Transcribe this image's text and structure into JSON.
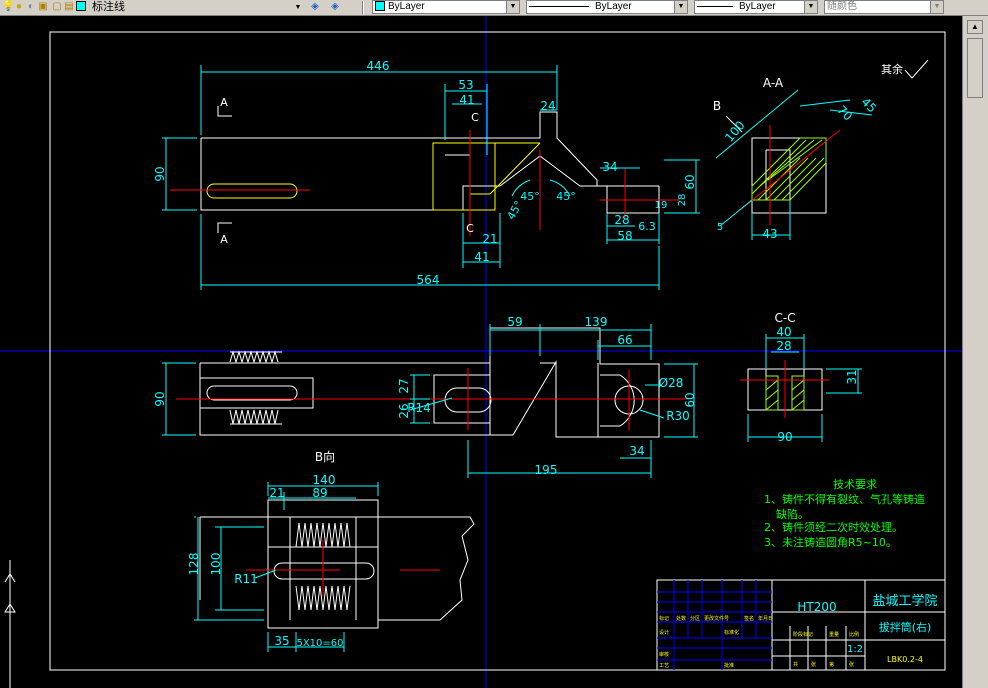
{
  "toolbar": {
    "layer_name": "标注线",
    "color_label": "ByLayer",
    "linetype_label": "ByLayer",
    "lineweight_label": "ByLayer",
    "plotstyle_label": "随颜色"
  },
  "drawing": {
    "surface_note": "其余",
    "top_view": {
      "dims": [
        "446",
        "53",
        "41",
        "24",
        "90",
        "34",
        "60",
        "28",
        "19",
        "28",
        "6.3",
        "58",
        "21",
        "41",
        "564"
      ],
      "angles": [
        "45°",
        "45°",
        "45°"
      ],
      "section_marks": [
        "A",
        "A",
        "C",
        "C"
      ]
    },
    "section_aa": {
      "title": "A-A",
      "view_mark": "B",
      "dims": [
        "100",
        "45",
        "70",
        "43",
        "5"
      ]
    },
    "front_view": {
      "dims": [
        "59",
        "139",
        "66",
        "90",
        "27",
        "26",
        "R14",
        "Ø28",
        "60",
        "R30",
        "195",
        "34"
      ]
    },
    "section_cc": {
      "title": "C-C",
      "dims": [
        "40",
        "28",
        "31",
        "90"
      ]
    },
    "view_b": {
      "title": "B向",
      "dims": [
        "140",
        "21",
        "89",
        "128",
        "100",
        "R11",
        "35",
        "5X10=60"
      ]
    },
    "tech_notes": {
      "title": "技术要求",
      "lines": [
        "1、铸件不得有裂纹、气孔等铸造",
        "缺陷。",
        "2、铸件须经二次时效处理。",
        "3、未注铸造圆角R5~10。"
      ]
    },
    "title_block": {
      "material": "HT200",
      "school": "盐城工学院",
      "part_name": "拔拌筒(右)",
      "scale": "1:2",
      "drawing_no": "LBK0.2-4",
      "small_labels": [
        "标记",
        "处数",
        "分区",
        "更改文件号",
        "签名",
        "年月日",
        "设计",
        "标准化",
        "审核",
        "工艺",
        "批准",
        "阶段标记",
        "重量",
        "比例",
        "共",
        "张",
        "第",
        "张"
      ]
    }
  }
}
